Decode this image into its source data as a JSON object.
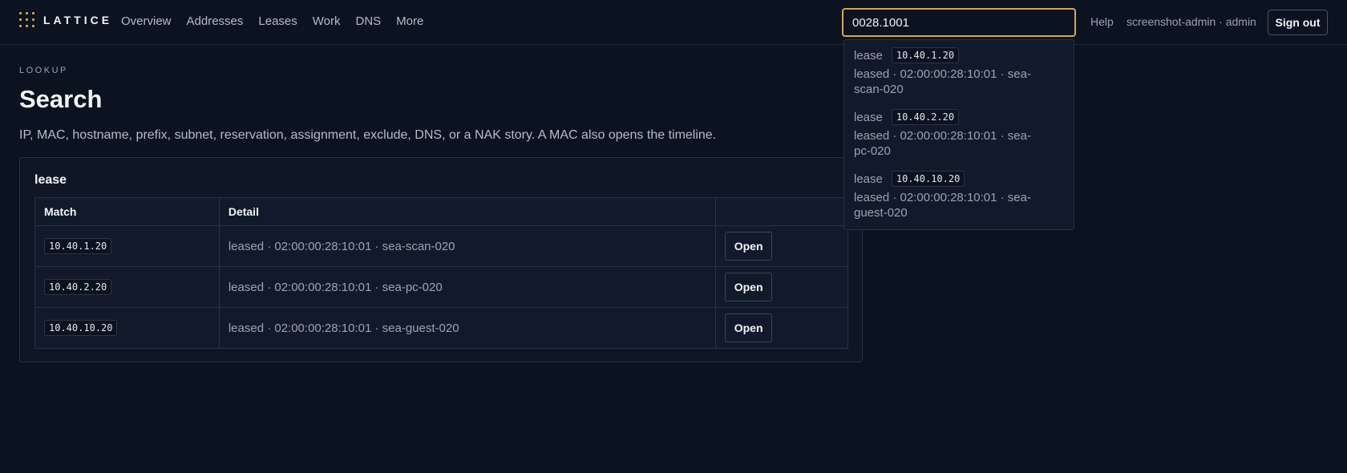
{
  "brand": {
    "name": "LATTICE"
  },
  "nav": {
    "items": [
      "Overview",
      "Addresses",
      "Leases",
      "Work",
      "DNS",
      "More"
    ]
  },
  "search": {
    "value": "0028.1001"
  },
  "header": {
    "help": "Help",
    "user": "screenshot-admin · admin",
    "sign_out": "Sign out"
  },
  "page": {
    "eyebrow": "LOOKUP",
    "title": "Search",
    "description": "IP, MAC, hostname, prefix, subnet, reservation, assignment, exclude, DNS, or a NAK story. A MAC also opens the timeline."
  },
  "results": {
    "group_title": "lease",
    "columns": [
      "Match",
      "Detail",
      ""
    ],
    "rows": [
      {
        "match": "10.40.1.20",
        "detail": "leased · 02:00:00:28:10:01 · sea-scan-020",
        "action": "Open"
      },
      {
        "match": "10.40.2.20",
        "detail": "leased · 02:00:00:28:10:01 · sea-pc-020",
        "action": "Open"
      },
      {
        "match": "10.40.10.20",
        "detail": "leased · 02:00:00:28:10:01 · sea-guest-020",
        "action": "Open"
      }
    ]
  },
  "dropdown": {
    "items": [
      {
        "type": "lease",
        "address": "10.40.1.20",
        "detail_line1": "leased · 02:00:00:28:10:01 · sea-",
        "detail_line2": "scan-020"
      },
      {
        "type": "lease",
        "address": "10.40.2.20",
        "detail_line1": "leased · 02:00:00:28:10:01 · sea-",
        "detail_line2": "pc-020"
      },
      {
        "type": "lease",
        "address": "10.40.10.20",
        "detail_line1": "leased · 02:00:00:28:10:01 · sea-",
        "detail_line2": "guest-020"
      }
    ]
  },
  "colors": {
    "accent": "#d4a94a",
    "background": "#0b1220",
    "surface": "#111a2b",
    "border": "#273244"
  }
}
